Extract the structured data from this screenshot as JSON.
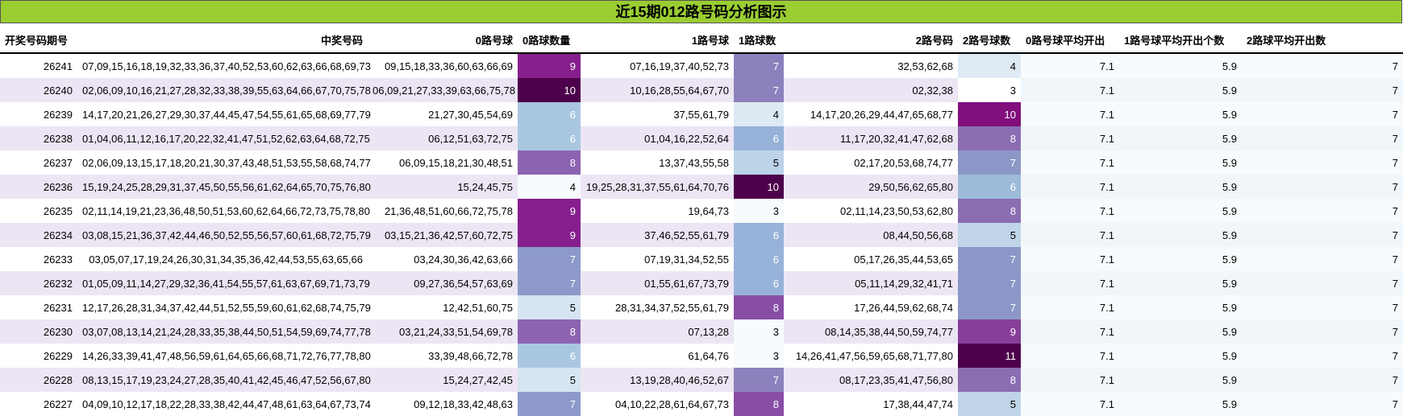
{
  "title": "近15期012路号码分析图示",
  "headers": [
    "开奖号码期号",
    "中奖号码",
    "0路号球",
    "0路球数量",
    "1路号球",
    "1路球数",
    "2路号码",
    "2路号球数",
    "0路号球平均开出",
    "1路号球平均开出个数",
    "2路球平均开出数"
  ],
  "rows": [
    {
      "issue": "26241",
      "numbers": "07,09,15,16,18,19,32,33,36,37,40,52,53,60,62,63,66,68,69,73",
      "r0": "09,15,18,33,36,60,63,66,69",
      "c0": "9",
      "r1": "07,16,19,37,40,52,73",
      "c1": "7",
      "r2": "32,53,62,68",
      "c2": "4",
      "a0": "7.1",
      "a1": "5.9",
      "a2": "7"
    },
    {
      "issue": "26240",
      "numbers": "02,06,09,10,16,21,27,28,32,33,38,39,55,63,64,66,67,70,75,78",
      "r0": "06,09,21,27,33,39,63,66,75,78",
      "c0": "10",
      "r1": "10,16,28,55,64,67,70",
      "c1": "7",
      "r2": "02,32,38",
      "c2": "3",
      "a0": "7.1",
      "a1": "5.9",
      "a2": "7"
    },
    {
      "issue": "26239",
      "numbers": "14,17,20,21,26,27,29,30,37,44,45,47,54,55,61,65,68,69,77,79",
      "r0": "21,27,30,45,54,69",
      "c0": "6",
      "r1": "37,55,61,79",
      "c1": "4",
      "r2": "14,17,20,26,29,44,47,65,68,77",
      "c2": "10",
      "a0": "7.1",
      "a1": "5.9",
      "a2": "7"
    },
    {
      "issue": "26238",
      "numbers": "01,04,06,11,12,16,17,20,22,32,41,47,51,52,62,63,64,68,72,75",
      "r0": "06,12,51,63,72,75",
      "c0": "6",
      "r1": "01,04,16,22,52,64",
      "c1": "6",
      "r2": "11,17,20,32,41,47,62,68",
      "c2": "8",
      "a0": "7.1",
      "a1": "5.9",
      "a2": "7"
    },
    {
      "issue": "26237",
      "numbers": "02,06,09,13,15,17,18,20,21,30,37,43,48,51,53,55,58,68,74,77",
      "r0": "06,09,15,18,21,30,48,51",
      "c0": "8",
      "r1": "13,37,43,55,58",
      "c1": "5",
      "r2": "02,17,20,53,68,74,77",
      "c2": "7",
      "a0": "7.1",
      "a1": "5.9",
      "a2": "7"
    },
    {
      "issue": "26236",
      "numbers": "15,19,24,25,28,29,31,37,45,50,55,56,61,62,64,65,70,75,76,80",
      "r0": "15,24,45,75",
      "c0": "4",
      "r1": "19,25,28,31,37,55,61,64,70,76",
      "c1": "10",
      "r2": "29,50,56,62,65,80",
      "c2": "6",
      "a0": "7.1",
      "a1": "5.9",
      "a2": "7"
    },
    {
      "issue": "26235",
      "numbers": "02,11,14,19,21,23,36,48,50,51,53,60,62,64,66,72,73,75,78,80",
      "r0": "21,36,48,51,60,66,72,75,78",
      "c0": "9",
      "r1": "19,64,73",
      "c1": "3",
      "r2": "02,11,14,23,50,53,62,80",
      "c2": "8",
      "a0": "7.1",
      "a1": "5.9",
      "a2": "7"
    },
    {
      "issue": "26234",
      "numbers": "03,08,15,21,36,37,42,44,46,50,52,55,56,57,60,61,68,72,75,79",
      "r0": "03,15,21,36,42,57,60,72,75",
      "c0": "9",
      "r1": "37,46,52,55,61,79",
      "c1": "6",
      "r2": "08,44,50,56,68",
      "c2": "5",
      "a0": "7.1",
      "a1": "5.9",
      "a2": "7"
    },
    {
      "issue": "26233",
      "numbers": "03,05,07,17,19,24,26,30,31,34,35,36,42,44,53,55,63,65,66",
      "r0": "03,24,30,36,42,63,66",
      "c0": "7",
      "r1": "07,19,31,34,52,55",
      "c1": "6",
      "r2": "05,17,26,35,44,53,65",
      "c2": "7",
      "a0": "7.1",
      "a1": "5.9",
      "a2": "7"
    },
    {
      "issue": "26232",
      "numbers": "01,05,09,11,14,27,29,32,36,41,54,55,57,61,63,67,69,71,73,79",
      "r0": "09,27,36,54,57,63,69",
      "c0": "7",
      "r1": "01,55,61,67,73,79",
      "c1": "6",
      "r2": "05,11,14,29,32,41,71",
      "c2": "7",
      "a0": "7.1",
      "a1": "5.9",
      "a2": "7"
    },
    {
      "issue": "26231",
      "numbers": "12,17,26,28,31,34,37,42,44,51,52,55,59,60,61,62,68,74,75,79",
      "r0": "12,42,51,60,75",
      "c0": "5",
      "r1": "28,31,34,37,52,55,61,79",
      "c1": "8",
      "r2": "17,26,44,59,62,68,74",
      "c2": "7",
      "a0": "7.1",
      "a1": "5.9",
      "a2": "7"
    },
    {
      "issue": "26230",
      "numbers": "03,07,08,13,14,21,24,28,33,35,38,44,50,51,54,59,69,74,77,78",
      "r0": "03,21,24,33,51,54,69,78",
      "c0": "8",
      "r1": "07,13,28",
      "c1": "3",
      "r2": "08,14,35,38,44,50,59,74,77",
      "c2": "9",
      "a0": "7.1",
      "a1": "5.9",
      "a2": "7"
    },
    {
      "issue": "26229",
      "numbers": "14,26,33,39,41,47,48,56,59,61,64,65,66,68,71,72,76,77,78,80",
      "r0": "33,39,48,66,72,78",
      "c0": "6",
      "r1": "61,64,76",
      "c1": "3",
      "r2": "14,26,41,47,56,59,65,68,71,77,80",
      "c2": "11",
      "a0": "7.1",
      "a1": "5.9",
      "a2": "7"
    },
    {
      "issue": "26228",
      "numbers": "08,13,15,17,19,23,24,27,28,35,40,41,42,45,46,47,52,56,67,80",
      "r0": "15,24,27,42,45",
      "c0": "5",
      "r1": "13,19,28,40,46,52,67",
      "c1": "7",
      "r2": "08,17,23,35,41,47,56,80",
      "c2": "8",
      "a0": "7.1",
      "a1": "5.9",
      "a2": "7"
    },
    {
      "issue": "26227",
      "numbers": "04,09,10,12,17,18,22,28,33,38,42,44,47,48,61,63,64,67,73,74",
      "r0": "09,12,18,33,42,48,63",
      "c0": "7",
      "r1": "04,10,22,28,61,64,67,73",
      "c1": "8",
      "r2": "17,38,44,47,74",
      "c2": "5",
      "a0": "7.1",
      "a1": "5.9",
      "a2": "7"
    }
  ],
  "colors": {
    "title_bg": "#9ACD32",
    "row_even_bg": "#ECE6F4",
    "avg_bg": "#F3F8FC",
    "scale": {
      "3": "#F7FBFD",
      "4": "#F7FBFD",
      "5": "#BED3E8",
      "6": "#9AB8DA",
      "7": "#8C8CC4",
      "8": "#8C61B0",
      "9": "#861F8D",
      "10": "#4D004B",
      "11": "#4D004B"
    },
    "scale_by_col": {
      "c0": {
        "4": "#F7FBFD",
        "5": "#D6E5F1",
        "6": "#A9C6E1",
        "7": "#8C99CA",
        "8": "#8C63B1",
        "9": "#861F8D",
        "10": "#4D004B"
      },
      "c1": {
        "3": "#F7FBFD",
        "4": "#DDE9F3",
        "5": "#BDD3E8",
        "6": "#97B2D9",
        "7": "#8C81BD",
        "8": "#884EA5",
        "10": "#4D004B"
      },
      "c2": {
        "3": "#FFFFFF",
        "4": "#DFEBF4",
        "5": "#C0D4E8",
        "6": "#9EBBDA",
        "7": "#8C97C8",
        "8": "#8B6DB3",
        "9": "#873E99",
        "10": "#810F7C",
        "11": "#4D004B"
      }
    }
  }
}
